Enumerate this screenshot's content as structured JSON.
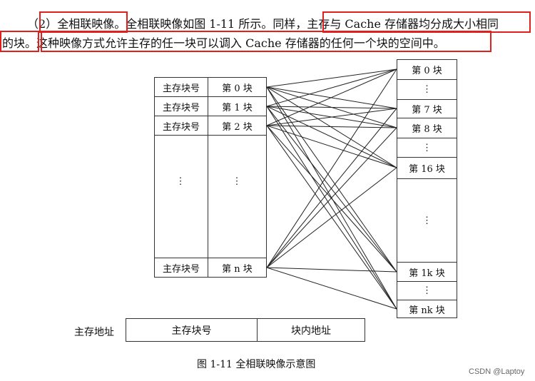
{
  "text": {
    "line1_prefix": "（2）",
    "line1_title": "全相联映像。",
    "line1_mid": "全相联映像如图 1-11 所示。同样，",
    "line1_tail": "主存与 Cache 存储器均分成大小相同",
    "line2_head": "的块。",
    "line2_tail": "这种映像方式允许主存的任一块可以调入 Cache 存储器的任何一个块的空间中。"
  },
  "main_memory": {
    "rows": [
      {
        "label": "主存块号",
        "block": "第 0 块"
      },
      {
        "label": "主存块号",
        "block": "第 1 块"
      },
      {
        "label": "主存块号",
        "block": "第 2 块"
      },
      {
        "label": "主存块号",
        "block": "第 n 块"
      }
    ],
    "ellipsis": "⋮"
  },
  "cache": {
    "blocks": [
      "第 0 块",
      "⋮",
      "第 7 块",
      "第 8 块",
      "⋮",
      "第 16 块",
      "⋮",
      "第 1k 块",
      "⋮",
      "第 nk 块"
    ]
  },
  "address": {
    "label": "主存地址",
    "field1": "主存块号",
    "field2": "块内地址"
  },
  "caption": "图 1-11    全相联映像示意图",
  "watermark": "CSDN @Laptoy",
  "colors": {
    "highlight": "#e0201d",
    "line": "#222222"
  }
}
